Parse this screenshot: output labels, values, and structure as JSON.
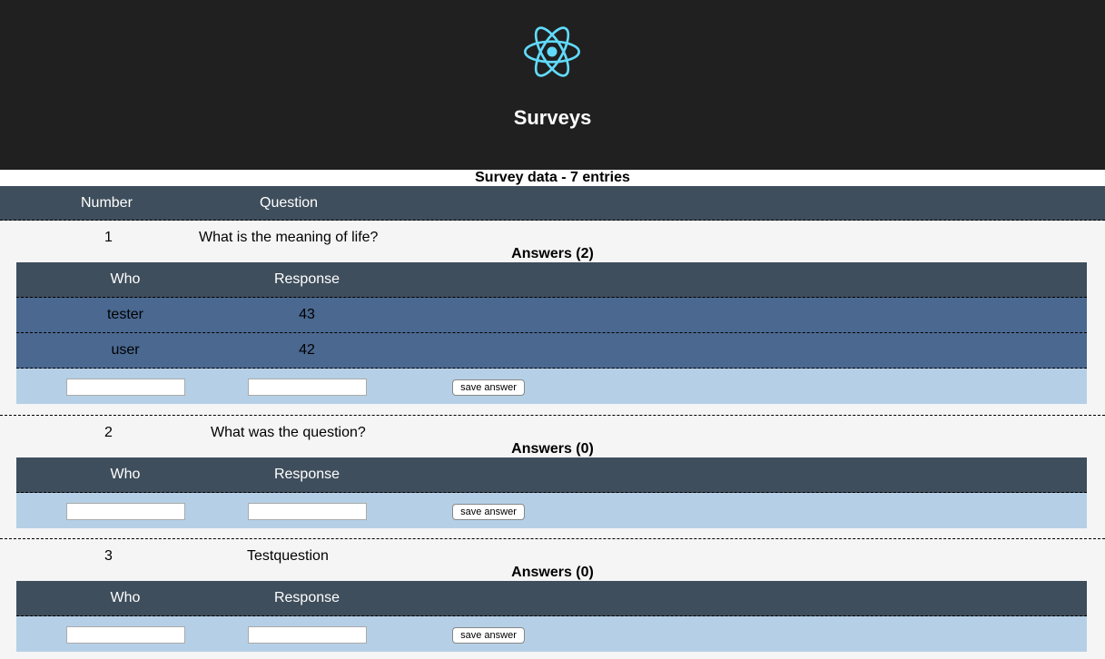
{
  "header": {
    "logo_icon": "react-atom-icon",
    "logo_color": "#61dafb",
    "title": "Surveys"
  },
  "summary": "Survey data - 7 entries",
  "columns": {
    "number": "Number",
    "question": "Question"
  },
  "answer_columns": {
    "who": "Who",
    "response": "Response"
  },
  "save_label": "save answer",
  "surveys": [
    {
      "number": "1",
      "question": "What is the meaning of life?",
      "answers_title": "Answers (2)",
      "answers": [
        {
          "who": "tester",
          "response": "43"
        },
        {
          "who": "user",
          "response": "42"
        }
      ],
      "who_value": "",
      "response_value": ""
    },
    {
      "number": "2",
      "question": "What was the question?",
      "answers_title": "Answers (0)",
      "answers": [],
      "who_value": "",
      "response_value": ""
    },
    {
      "number": "3",
      "question": "Testquestion",
      "answers_title": "Answers (0)",
      "answers": [],
      "who_value": "",
      "response_value": ""
    }
  ]
}
